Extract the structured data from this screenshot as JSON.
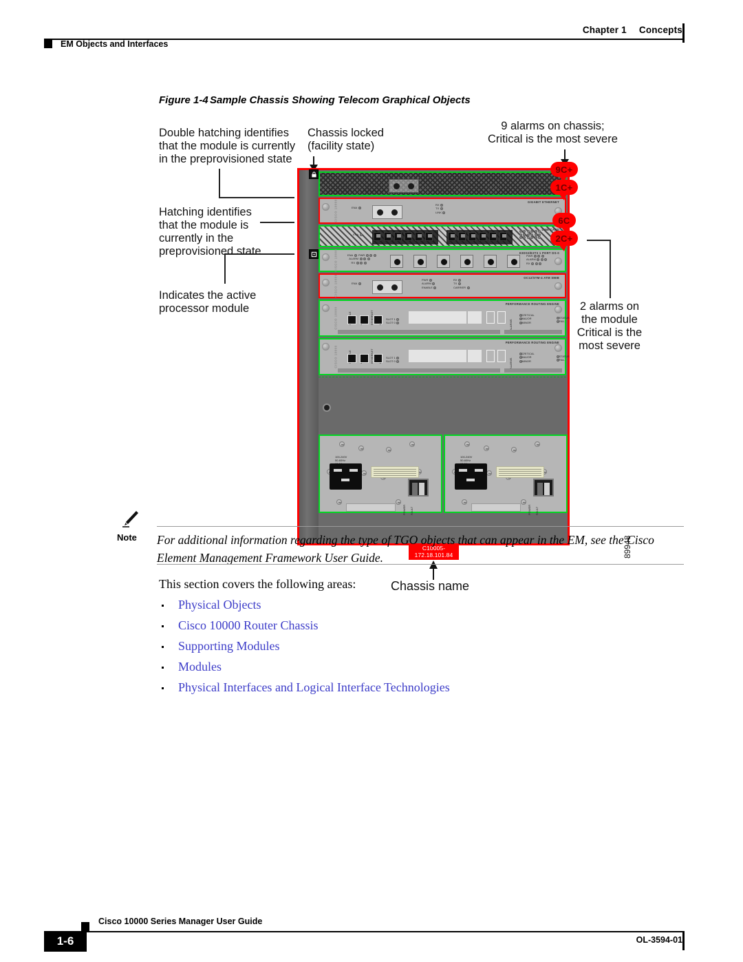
{
  "header": {
    "chapter": "Chapter 1",
    "chapter_title": "Concepts",
    "section": "EM Objects and Interfaces"
  },
  "figure": {
    "number": "Figure 1-4",
    "title": "Sample Chassis Showing Telecom Graphical Objects",
    "graphic_id": "89948",
    "chassis_name_line1": "C10005-",
    "chassis_name_line2": "172.18.101.84",
    "chassis_name_caption": "Chassis name",
    "annotations": {
      "double_hatching": "Double hatching identifies\nthat the module is currently\nin the preprovisioned state",
      "hatching": "Hatching identifies\nthat the module is\ncurrently in the\npreprovisioned state",
      "active_processor": "Indicates the active\nprocessor module",
      "chassis_locked": "Chassis locked\n(facility state)",
      "chassis_alarms": "9 alarms on chassis;\nCritical is the most severe",
      "module_alarms": "2 alarms on\nthe module\nCritical is the\nmost severe"
    },
    "alarm_badges": [
      {
        "label": "9C+"
      },
      {
        "label": "1C+"
      },
      {
        "label": "6C"
      },
      {
        "label": "2C+"
      }
    ],
    "glyphs": {
      "lock": "■",
      "processor": "▣"
    },
    "modules": [
      {
        "name": "",
        "style": "double-hatched"
      },
      {
        "name": "GIGABIT ETHERNET",
        "style": "plain"
      },
      {
        "name": "LINE CARD",
        "style": "hatched"
      },
      {
        "name": "E3DS3/E3T3 1 PORT DS-0",
        "style": "plain"
      },
      {
        "name": "OC12/STM-4 ATM SMIB",
        "style": "plain"
      },
      {
        "name": "PERFORMANCE ROUTING ENGINE",
        "style": "plain"
      },
      {
        "name": "PERFORMANCE ROUTING ENGINE",
        "style": "plain"
      }
    ],
    "led_labels": {
      "enabled": "ENA",
      "rx": "RX",
      "tx": "TX",
      "link": "LINK",
      "pwr": "PWR",
      "alarm": "ALARM",
      "enable": "ENABLE",
      "carrier": "CARRIER",
      "critical": "CRITICAL",
      "major": "MAJOR",
      "minor": "MINOR",
      "status": "STATUS",
      "fail": "FAIL",
      "aux": "AUX",
      "console": "CONSOLE",
      "ethernet": "ETHERNET",
      "slot1": "SLOT 1",
      "slot0": "SLOT 0"
    },
    "psu": {
      "rating": "100-240V\n50-60Hz\n10-5A",
      "power_label": "POWER",
      "fault_label": "FAULT"
    }
  },
  "note": {
    "label": "Note",
    "text": "For additional information regarding the type of TGO objects that can appear in the EM, see the Cisco Element Management Framework User Guide."
  },
  "body": {
    "intro": "This section covers the following areas:",
    "links": [
      "Physical Objects",
      "Cisco 10000 Router Chassis",
      "Supporting Modules",
      "Modules",
      "Physical Interfaces and Logical Interface Technologies"
    ]
  },
  "footer": {
    "title": "Cisco 10000 Series Manager User Guide",
    "page": "1-6",
    "doc_id": "OL-3594-01"
  },
  "colors": {
    "alarm_red": "#ff0000",
    "ok_green": "#00d820",
    "link_blue": "#3c3cc8",
    "chassis_grey": "#6b6b6b"
  }
}
